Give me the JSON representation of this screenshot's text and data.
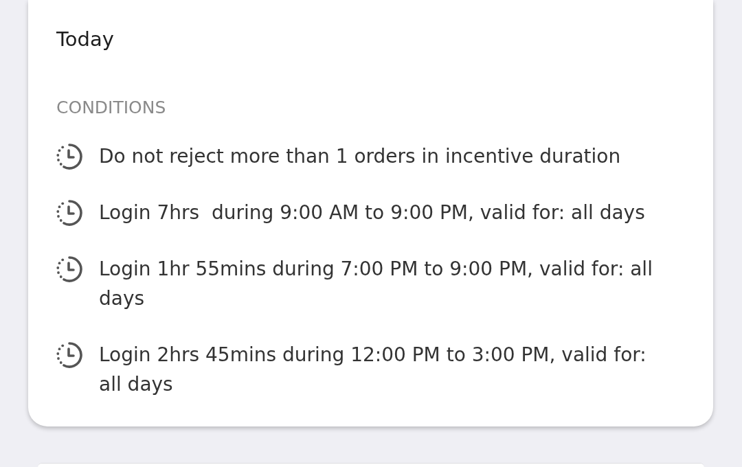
{
  "validity": {
    "value": "Today"
  },
  "conditions": {
    "heading": "CONDITIONS",
    "items": [
      {
        "text": "Do not reject more than 1 orders in incentive duration"
      },
      {
        "text": "Login 7hrs  during 9:00 AM to 9:00 PM, valid for: all days"
      },
      {
        "text": "Login 1hr 55mins during 7:00 PM to 9:00 PM, valid for: all days"
      },
      {
        "text": "Login 2hrs 45mins during 12:00 PM to 3:00 PM, valid for: all days"
      }
    ]
  }
}
